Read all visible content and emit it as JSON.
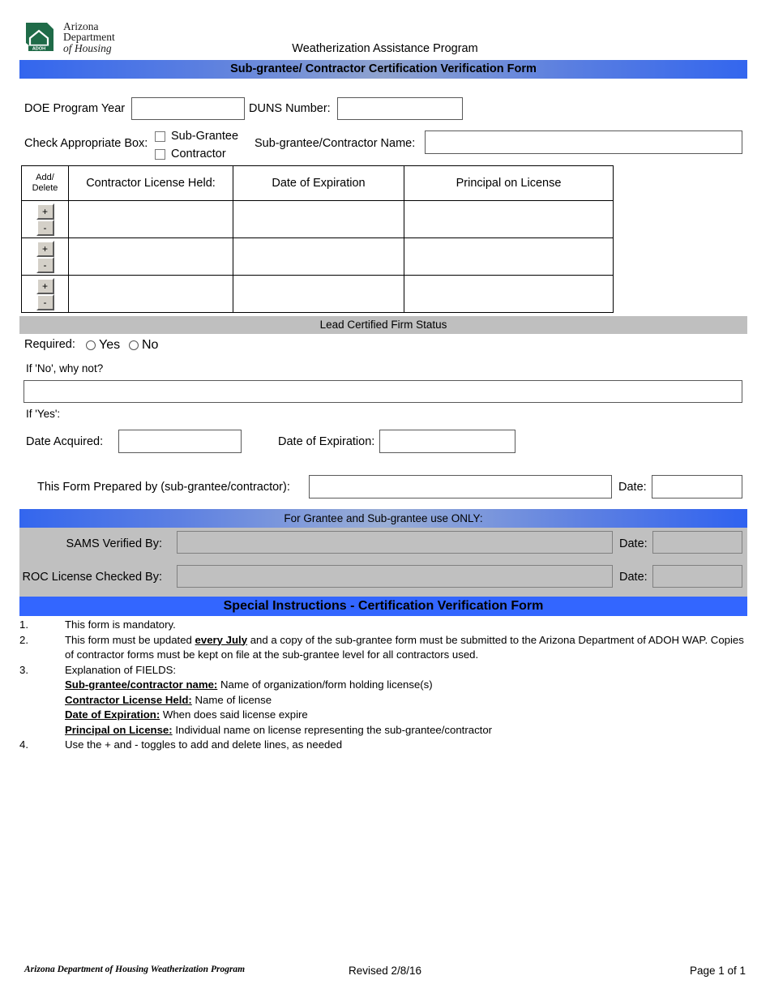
{
  "logo": {
    "icon": "arizona-state-house-logo",
    "badge_text": "ADOH",
    "line1": "Arizona",
    "line2": "Department",
    "line3": "of Housing"
  },
  "header": {
    "program_title": "Weatherization Assistance Program",
    "form_title": "Sub-grantee/ Contractor Certification Verification Form"
  },
  "top_fields": {
    "doe_program_year_label": "DOE Program Year",
    "doe_program_year_value": "",
    "duns_label": "DUNS Number:",
    "duns_value": "",
    "check_box_label": "Check Appropriate Box:",
    "sub_grantee_option": "Sub-Grantee",
    "contractor_option": "Contractor",
    "name_label": "Sub-grantee/Contractor Name:",
    "name_value": ""
  },
  "license_table": {
    "headers": {
      "add_delete_line1": "Add/",
      "add_delete_line2": "Delete",
      "license_held": "Contractor License Held:",
      "date_of_expiration": "Date of Expiration",
      "principal_on_license": "Principal on License"
    },
    "add_button_label": "+",
    "delete_button_label": "-",
    "rows": [
      {
        "license_held": "",
        "date_of_expiration": "",
        "principal_on_license": ""
      },
      {
        "license_held": "",
        "date_of_expiration": "",
        "principal_on_license": ""
      },
      {
        "license_held": "",
        "date_of_expiration": "",
        "principal_on_license": ""
      }
    ]
  },
  "lead_status": {
    "section_title": "Lead Certified Firm Status",
    "required_label": "Required:",
    "yes_label": "Yes",
    "no_label": "No",
    "if_no_label": "If 'No', why not?",
    "if_no_value": "",
    "if_yes_label": "If 'Yes':",
    "date_acquired_label": "Date Acquired:",
    "date_acquired_value": "",
    "date_expiration_label": "Date of Expiration:",
    "date_expiration_value": ""
  },
  "prepared_by": {
    "label": "This Form Prepared by (sub-grantee/contractor):",
    "value": "",
    "date_label": "Date:",
    "date_value": ""
  },
  "grantee_only": {
    "bar_title": "For Grantee and Sub-grantee use ONLY:",
    "sams_label": "SAMS Verified By:",
    "sams_value": "",
    "sams_date_label": "Date:",
    "sams_date_value": "",
    "roc_label": "ROC License Checked By:",
    "roc_value": "",
    "roc_date_label": "Date:",
    "roc_date_value": ""
  },
  "instructions": {
    "bar_title": "Special Instructions - Certification Verification Form",
    "item1_num": "1.",
    "item1_text": "This form is mandatory.",
    "item2_num": "2.",
    "item2_part1": "This form must be updated ",
    "item2_bold": "every July",
    "item2_part2": " and a copy of the sub-grantee form must be submitted to the Arizona Department of ADOH WAP. Copies of contractor forms must be kept on file at the sub-grantee level for all contractors used.",
    "item3_num": "3.",
    "item3_text": "Explanation of FIELDS:",
    "field1_term": "Sub-grantee/contractor name:",
    "field1_def": " Name of organization/form holding license(s)",
    "field2_term": "Contractor License Held:",
    "field2_def": " Name of license",
    "field3_term": "Date of Expiration:",
    "field3_def": "  When does said license expire",
    "field4_term": "Principal on License:",
    "field4_def": " Individual name on license representing the sub-grantee/contractor",
    "item4_num": "4.",
    "item4_text": "Use the + and - toggles to add and delete lines, as needed"
  },
  "footer": {
    "left": "Arizona Department of Housing Weatherization Program",
    "center": "Revised 2/8/16",
    "right": "Page 1 of 1"
  },
  "colors": {
    "banner_blue": "#3366ee",
    "solid_blue": "#3366ff",
    "gray_bar": "#bfbfbf",
    "gray_block": "#c0c0c0",
    "logo_green": "#1f6b48"
  }
}
